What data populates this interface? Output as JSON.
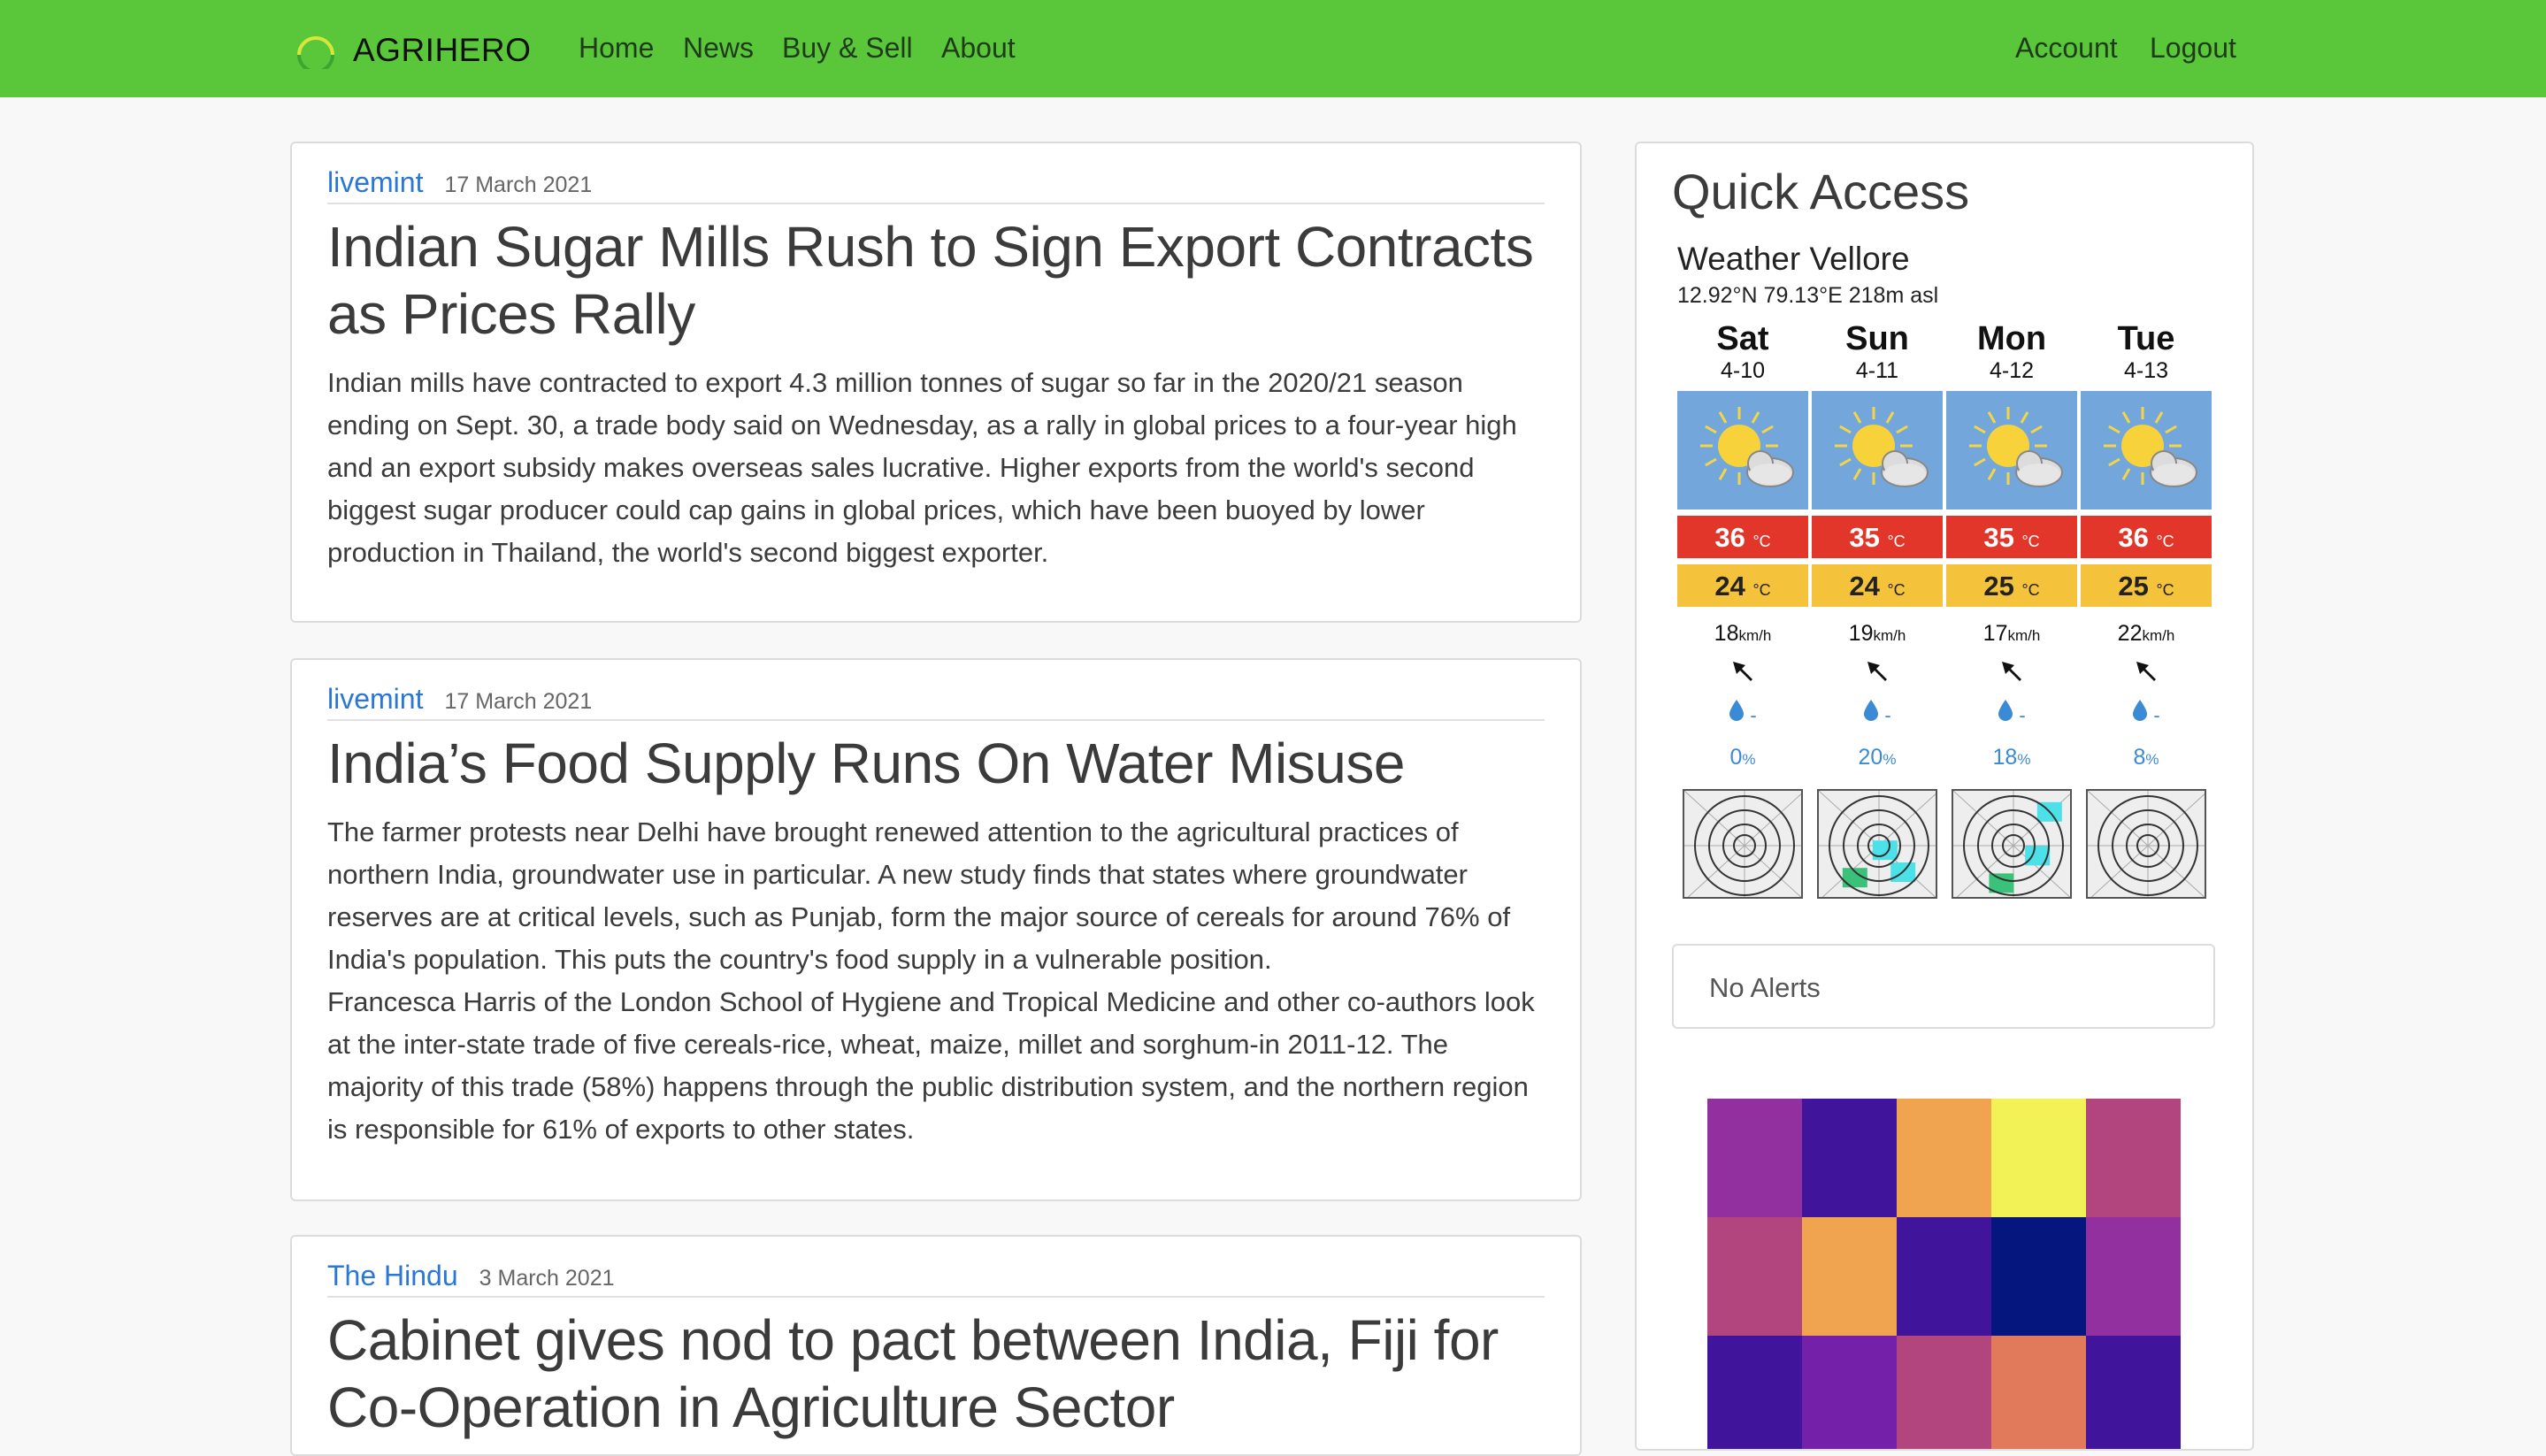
{
  "navbar": {
    "brand": "AGRIHERO",
    "links": [
      "Home",
      "News",
      "Buy & Sell",
      "About"
    ],
    "right_links": [
      "Account",
      "Logout"
    ],
    "bg_color": "#5ac73b"
  },
  "articles": [
    {
      "source": "livemint",
      "date": "17 March 2021",
      "title": "Indian Sugar Mills Rush to Sign Export Contracts as Prices Rally",
      "body": [
        "Indian mills have contracted to export 4.3 million tonnes of sugar so far in the 2020/21 season ending on Sept. 30, a trade body said on Wednesday, as a rally in global prices to a four-year high and an export subsidy makes overseas sales lucrative. Higher exports from the world's second biggest sugar producer could cap gains in global prices, which have been buoyed by lower production in Thailand, the world's second biggest exporter."
      ]
    },
    {
      "source": "livemint",
      "date": "17 March 2021",
      "title": "India’s Food Supply Runs On Water Misuse",
      "body": [
        "The farmer protests near Delhi have brought renewed attention to the agricultural practices of northern India, groundwater use in particular. A new study finds that states where groundwater reserves are at critical levels, such as Punjab, form the major source of cereals for around 76% of India's population. This puts the country's food supply in a vulnerable position.",
        "Francesca Harris of the London School of Hygiene and Tropical Medicine and other co-authors look at the inter-state trade of five cereals-rice, wheat, maize, millet and sorghum-in 2011-12. The majority of this trade (58%) happens through the public distribution system, and the northern region is responsible for 61% of exports to other states."
      ]
    },
    {
      "source": "The Hindu",
      "date": "3 March 2021",
      "title": "Cabinet gives nod to pact between India, Fiji for Co-Operation in Agriculture Sector",
      "body": []
    }
  ],
  "quick_access": {
    "title": "Quick Access",
    "weather": {
      "city": "Weather Vellore",
      "coords": "12.92°N 79.13°E 218m asl",
      "temp_unit": "°C",
      "wind_unit": "km/h",
      "precip_placeholder": "-",
      "pct_unit": "%",
      "days": [
        {
          "day": "Sat",
          "date": "4-10",
          "max": "36",
          "min": "24",
          "wind": "18",
          "precip_prob": "0"
        },
        {
          "day": "Sun",
          "date": "4-11",
          "max": "35",
          "min": "24",
          "wind": "19",
          "precip_prob": "20"
        },
        {
          "day": "Mon",
          "date": "4-12",
          "max": "35",
          "min": "25",
          "wind": "17",
          "precip_prob": "18"
        },
        {
          "day": "Tue",
          "date": "4-13",
          "max": "36",
          "min": "25",
          "wind": "22",
          "precip_prob": "8"
        }
      ],
      "colors": {
        "sky": "#73a7dc",
        "max_temp": "#e3362a",
        "min_temp": "#f4c23b",
        "precip": "#3a8ad6"
      }
    },
    "alerts_text": "No Alerts",
    "heatmap_colors": [
      [
        "#9330a0",
        "#40159c",
        "#f0a450",
        "#f2f257",
        "#b2457d"
      ],
      [
        "#b2457d",
        "#f0a450",
        "#40159c",
        "#05177e",
        "#9330a0"
      ],
      [
        "#40159c",
        "#7420a8",
        "#b2457d",
        "#e07a5a",
        "#40159c"
      ]
    ]
  }
}
